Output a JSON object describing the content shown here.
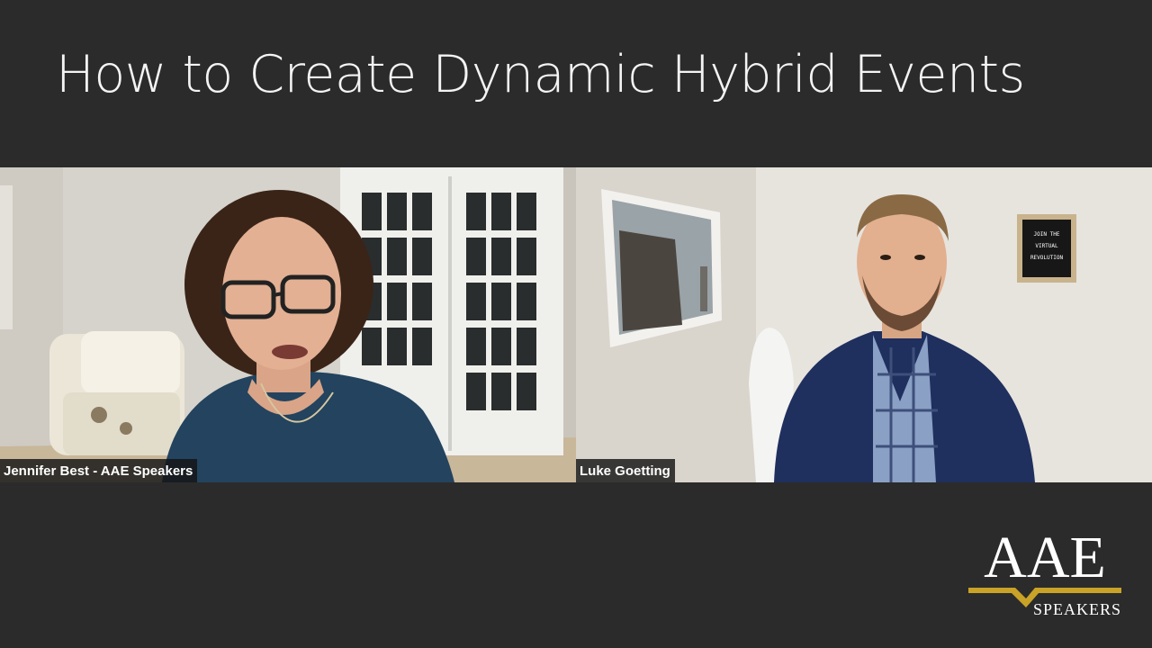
{
  "slide": {
    "title": "How to Create Dynamic Hybrid Events"
  },
  "participants": [
    {
      "name": "Jennifer Best - AAE Speakers"
    },
    {
      "name": "Luke Goetting"
    }
  ],
  "letter_board": [
    "JOIN THE",
    "VIRTUAL",
    "REVOLUTION"
  ],
  "logo": {
    "wordmark": "AAE",
    "subtitle": "SPEAKERS",
    "accent_color": "#c9a227"
  },
  "colors": {
    "background": "#2b2b2b",
    "title_text": "#f4f4f4"
  }
}
